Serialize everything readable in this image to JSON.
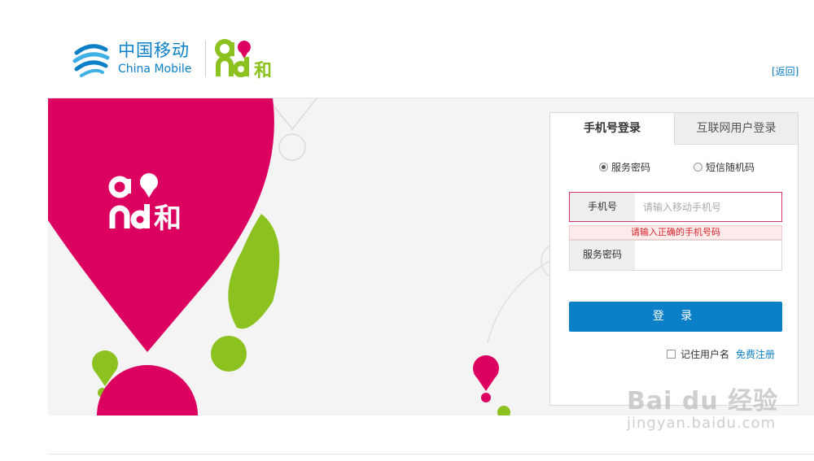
{
  "header": {
    "brand_cn": "中国移动",
    "brand_en": "China Mobile",
    "back_link": "[返回]"
  },
  "tabs": [
    {
      "label": "手机号登录",
      "active": true
    },
    {
      "label": "互联网用户登录",
      "active": false
    }
  ],
  "login_mode": {
    "options": [
      "服务密码",
      "短信随机码"
    ],
    "selected": "服务密码"
  },
  "phone_field": {
    "label": "手机号",
    "placeholder": "请输入移动手机号",
    "value": ""
  },
  "error_message": "请输入正确的手机号码",
  "password_field": {
    "label": "服务密码",
    "value": ""
  },
  "login_button": "登 录",
  "remember_label": "记住用户名",
  "register_link": "免费注册",
  "watermark": {
    "main": "Bai du 经验",
    "sub": "jingyan.baidu.com"
  },
  "colors": {
    "brand_blue": "#0b7fc7",
    "and_magenta": "#dc0060",
    "and_green": "#8cc21f",
    "error_red": "#d9252b"
  }
}
